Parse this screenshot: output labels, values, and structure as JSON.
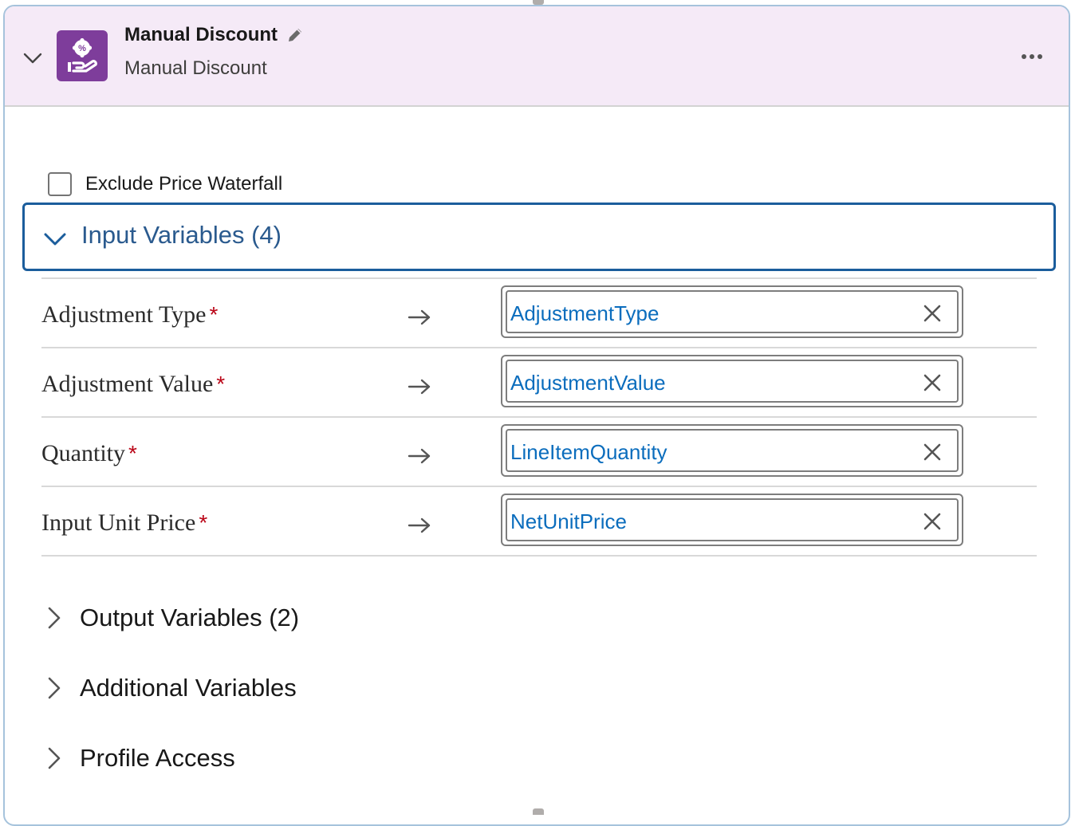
{
  "element": {
    "title": "Manual Discount",
    "subtitle": "Manual Discount",
    "icon": "discount-hand-icon",
    "icon_color": "#7e3d9b",
    "header_background": "#f5eaf7"
  },
  "exclude_price_waterfall": {
    "label": "Exclude Price Waterfall",
    "checked": false
  },
  "input_variables": {
    "title": "Input Variables (4)",
    "expanded": true,
    "rows": [
      {
        "label": "Adjustment Type",
        "required": "*",
        "value": "AdjustmentType"
      },
      {
        "label": "Adjustment Value",
        "required": "*",
        "value": "AdjustmentValue"
      },
      {
        "label": "Quantity",
        "required": "*",
        "value": "LineItemQuantity"
      },
      {
        "label": "Input Unit Price",
        "required": "*",
        "value": "NetUnitPrice"
      }
    ]
  },
  "sections": [
    {
      "label": "Output Variables (2)",
      "expanded": false
    },
    {
      "label": "Additional Variables",
      "expanded": false
    },
    {
      "label": "Profile Access",
      "expanded": false
    }
  ],
  "colors": {
    "accent_border": "#1b5d9c",
    "value_link": "#0b6dbd",
    "required": "#ba0517"
  }
}
